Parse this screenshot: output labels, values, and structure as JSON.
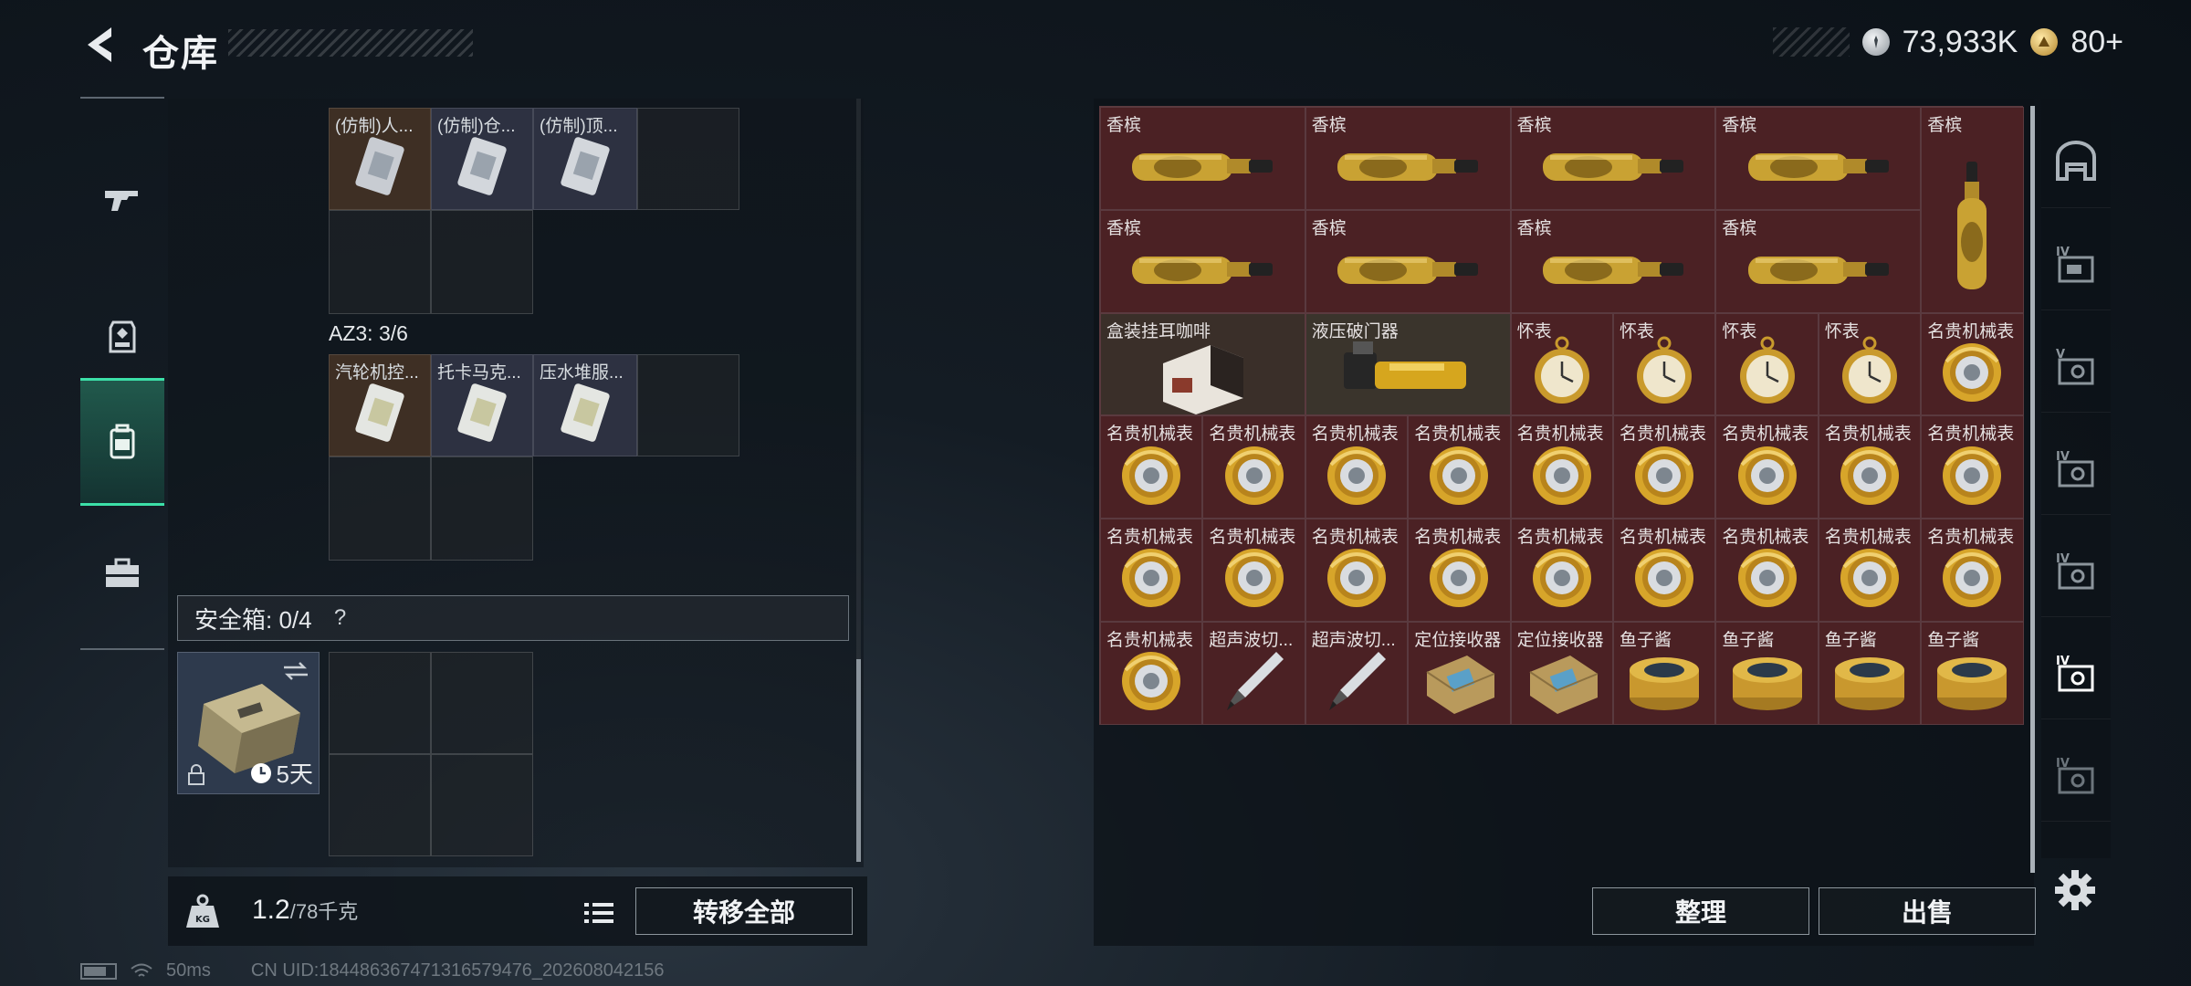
{
  "header": {
    "title": "仓库",
    "currency_silver": "73,933K",
    "currency_gold": "80+"
  },
  "left_rail": {
    "items": [
      {
        "name": "weapons",
        "icon": "gun-icon"
      },
      {
        "name": "equipment",
        "icon": "armor-icon"
      },
      {
        "name": "backpack",
        "icon": "backpack-icon",
        "active": true
      },
      {
        "name": "toolbox",
        "icon": "toolbox-icon"
      }
    ]
  },
  "container": {
    "row1_items": [
      "(仿制)人...",
      "(仿制)仓...",
      "(仿制)顶..."
    ],
    "section_label": "AZ3: 3/6",
    "row2_items": [
      "汽轮机控...",
      "托卡马克...",
      "压水堆服..."
    ],
    "safebox_label": "安全箱: 0/4",
    "help": "?",
    "safebox_days": "5天"
  },
  "bottom": {
    "weight_current": "1.2",
    "weight_max": "/78千克",
    "transfer_all": "转移全部",
    "sort": "整理",
    "sell": "出售"
  },
  "status_bar": {
    "ping": "50ms",
    "uid": "CN UID:18448636747131657947​6_202608042156"
  },
  "stash": {
    "champagne": "香槟",
    "coffee": "盒装挂耳咖啡",
    "breacher": "液压破门器",
    "pocket_watch": "怀表",
    "luxury_watch": "名贵机械表",
    "ultrasonic": "超声波切...",
    "locator": "定位接收器",
    "caviar": "鱼子酱"
  },
  "colors": {
    "accent": "#3ce0a8",
    "item_red": "#4b2124",
    "panel": "#0c1218"
  }
}
